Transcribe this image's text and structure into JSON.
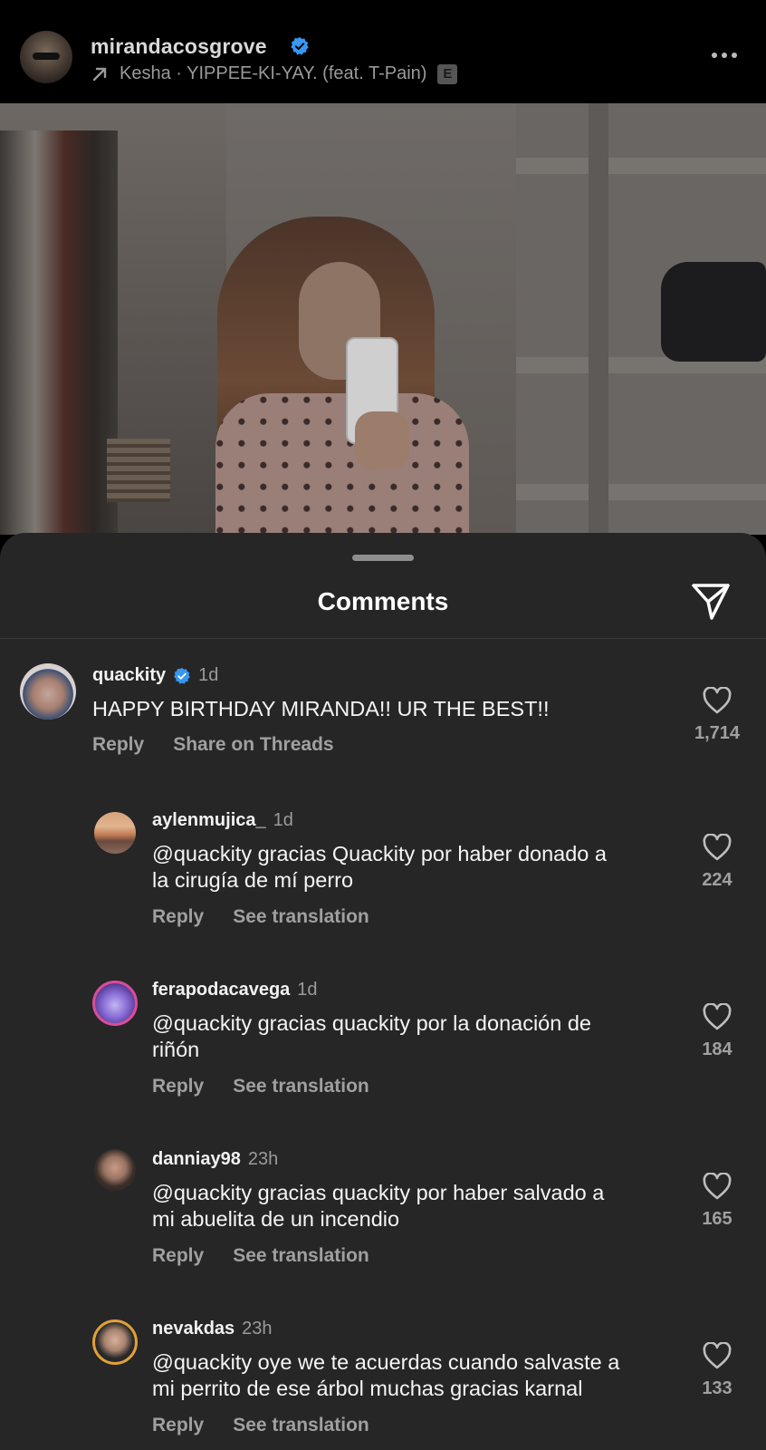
{
  "post": {
    "username": "mirandacosgrove",
    "music": "Kesha · YIPPEE-KI-YAY. (feat. T-Pain)",
    "explicit_badge": "E"
  },
  "comments_sheet": {
    "title": "Comments"
  },
  "comments": [
    {
      "username": "quackity",
      "verified": true,
      "time": "1d",
      "text": "HAPPY BIRTHDAY MIRANDA!! UR THE BEST!!",
      "actions": [
        "Reply",
        "Share on Threads"
      ],
      "likes": "1,714"
    },
    {
      "username": "aylenmujica_",
      "time": "1d",
      "text_line1": "@quackity gracias Quackity por haber donado a",
      "text_line2": "la cirugía de mí perro",
      "actions": [
        "Reply",
        "See translation"
      ],
      "likes": "224"
    },
    {
      "username": "ferapodacavega",
      "time": "1d",
      "text_line1": "@quackity gracias quackity por la donación de",
      "text_line2": "riñón",
      "actions": [
        "Reply",
        "See translation"
      ],
      "likes": "184"
    },
    {
      "username": "danniay98",
      "time": "23h",
      "text_line1": "@quackity gracias quackity por haber salvado a",
      "text_line2": "mi abuelita de un incendio",
      "actions": [
        "Reply",
        "See translation"
      ],
      "likes": "165"
    },
    {
      "username": "nevakdas",
      "time": "23h",
      "text_line1": "@quackity oye we te acuerdas cuando salvaste a",
      "text_line2": "mi perrito de ese árbol muchas gracias karnal",
      "actions": [
        "Reply",
        "See translation"
      ],
      "likes": "133"
    }
  ],
  "colors": {
    "background": "#000000",
    "sheet": "#262626",
    "verified_blue": "#3897f0",
    "secondary_text": "#a0a0a0"
  },
  "icons": [
    "verified-badge-icon",
    "music-arrow-icon",
    "more-options-icon",
    "share-direct-icon",
    "heart-outline-icon"
  ]
}
